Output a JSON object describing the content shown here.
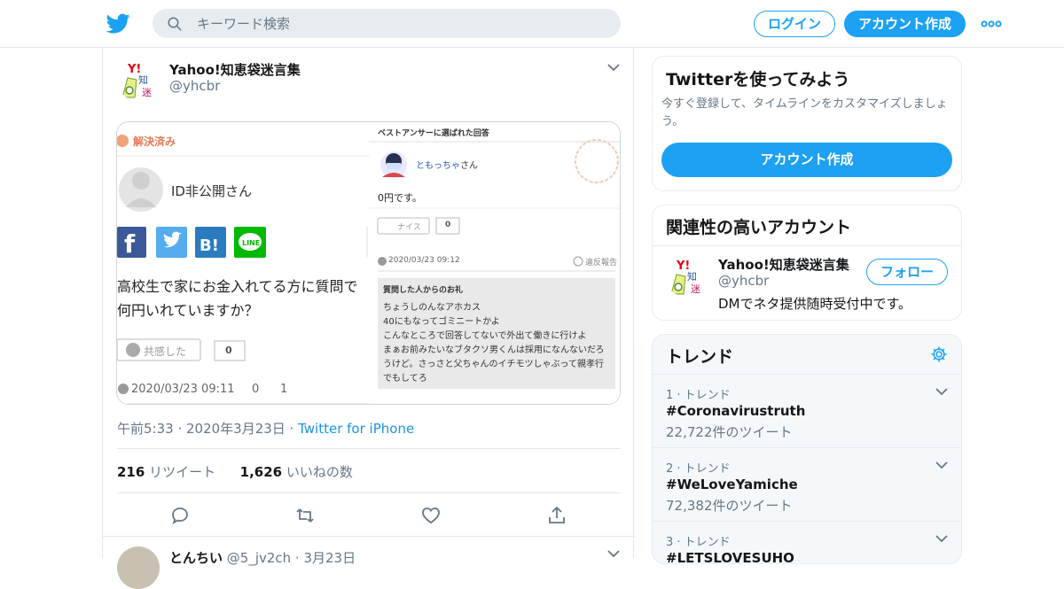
{
  "header": {
    "search_placeholder": "キーワード検索",
    "login_label": "ログイン",
    "signup_label": "アカウント作成"
  },
  "tweet": {
    "name": "Yahoo!知恵袋迷言集",
    "handle": "@yhcbr",
    "media": {
      "resolved_label": "解決済み",
      "asker_name": "ID非公開さん",
      "question": [
        "高校生で家にお金入れてる方に質問で",
        "何円いれていますか？"
      ],
      "empathy_label": "共感した",
      "empathy_count": "0",
      "question_date": "2020/03/23 09:11",
      "views": "0",
      "comments": "1",
      "best_answer_label": "ベストアンサーに選ばれた回答",
      "answerer_name": "ともっちゃ",
      "answerer_suffix": "さん",
      "answer_text": "0円です。",
      "nice_label": "ナイス",
      "nice_count": "0",
      "answer_date": "2020/03/23 09:12",
      "report_label": "違反報告",
      "thanks_title": "質問した人からのお礼",
      "thanks_lines": [
        "ちょうしのんなアホカス",
        "40にもなってゴミニートかよ",
        "こんなところで回答してないで外出て働きに行けよ",
        "まぁお前みたいなブタクソ男くんは採用になんないだろ",
        "うけど。さっさと父ちゃんのイチモツしゃぶって親孝行",
        "でもしてろ"
      ]
    },
    "timestamp": "午前5:33 · 2020年3月23日 · ",
    "via": "Twitter for iPhone",
    "retweets": "216",
    "retweets_label": " リツイート",
    "likes": "1,626",
    "likes_label": " いいねの数"
  },
  "next_tweet": {
    "name": "とんちい",
    "handle_date": " @5_jv2ch · 3月23日"
  },
  "sidebar": {
    "try_twitter": {
      "title": "Twitterを使ってみよう",
      "subtitle": "今すぐ登録して、タイムラインをカスタマイズしましょう。",
      "button": "アカウント作成"
    },
    "related": {
      "title": "関連性の高いアカウント",
      "name": "Yahoo!知恵袋迷言集",
      "handle": "@yhcbr",
      "bio": "DMでネタ提供随時受付中です。",
      "follow_label": "フォロー"
    },
    "trends": {
      "title": "トレンド",
      "items": [
        {
          "rank": "1 · トレンド",
          "tag": "#Coronavirustruth",
          "count": "22,722件のツイート"
        },
        {
          "rank": "2 · トレンド",
          "tag": "#WeLoveYamiche",
          "count": "72,382件のツイート"
        },
        {
          "rank": "3 · トレンド",
          "tag": "#LETSLOVESUHO",
          "count": ""
        }
      ]
    }
  },
  "colors": {
    "accent": "#1da1f2",
    "text_secondary": "#657786",
    "border": "#e1e8ed"
  }
}
